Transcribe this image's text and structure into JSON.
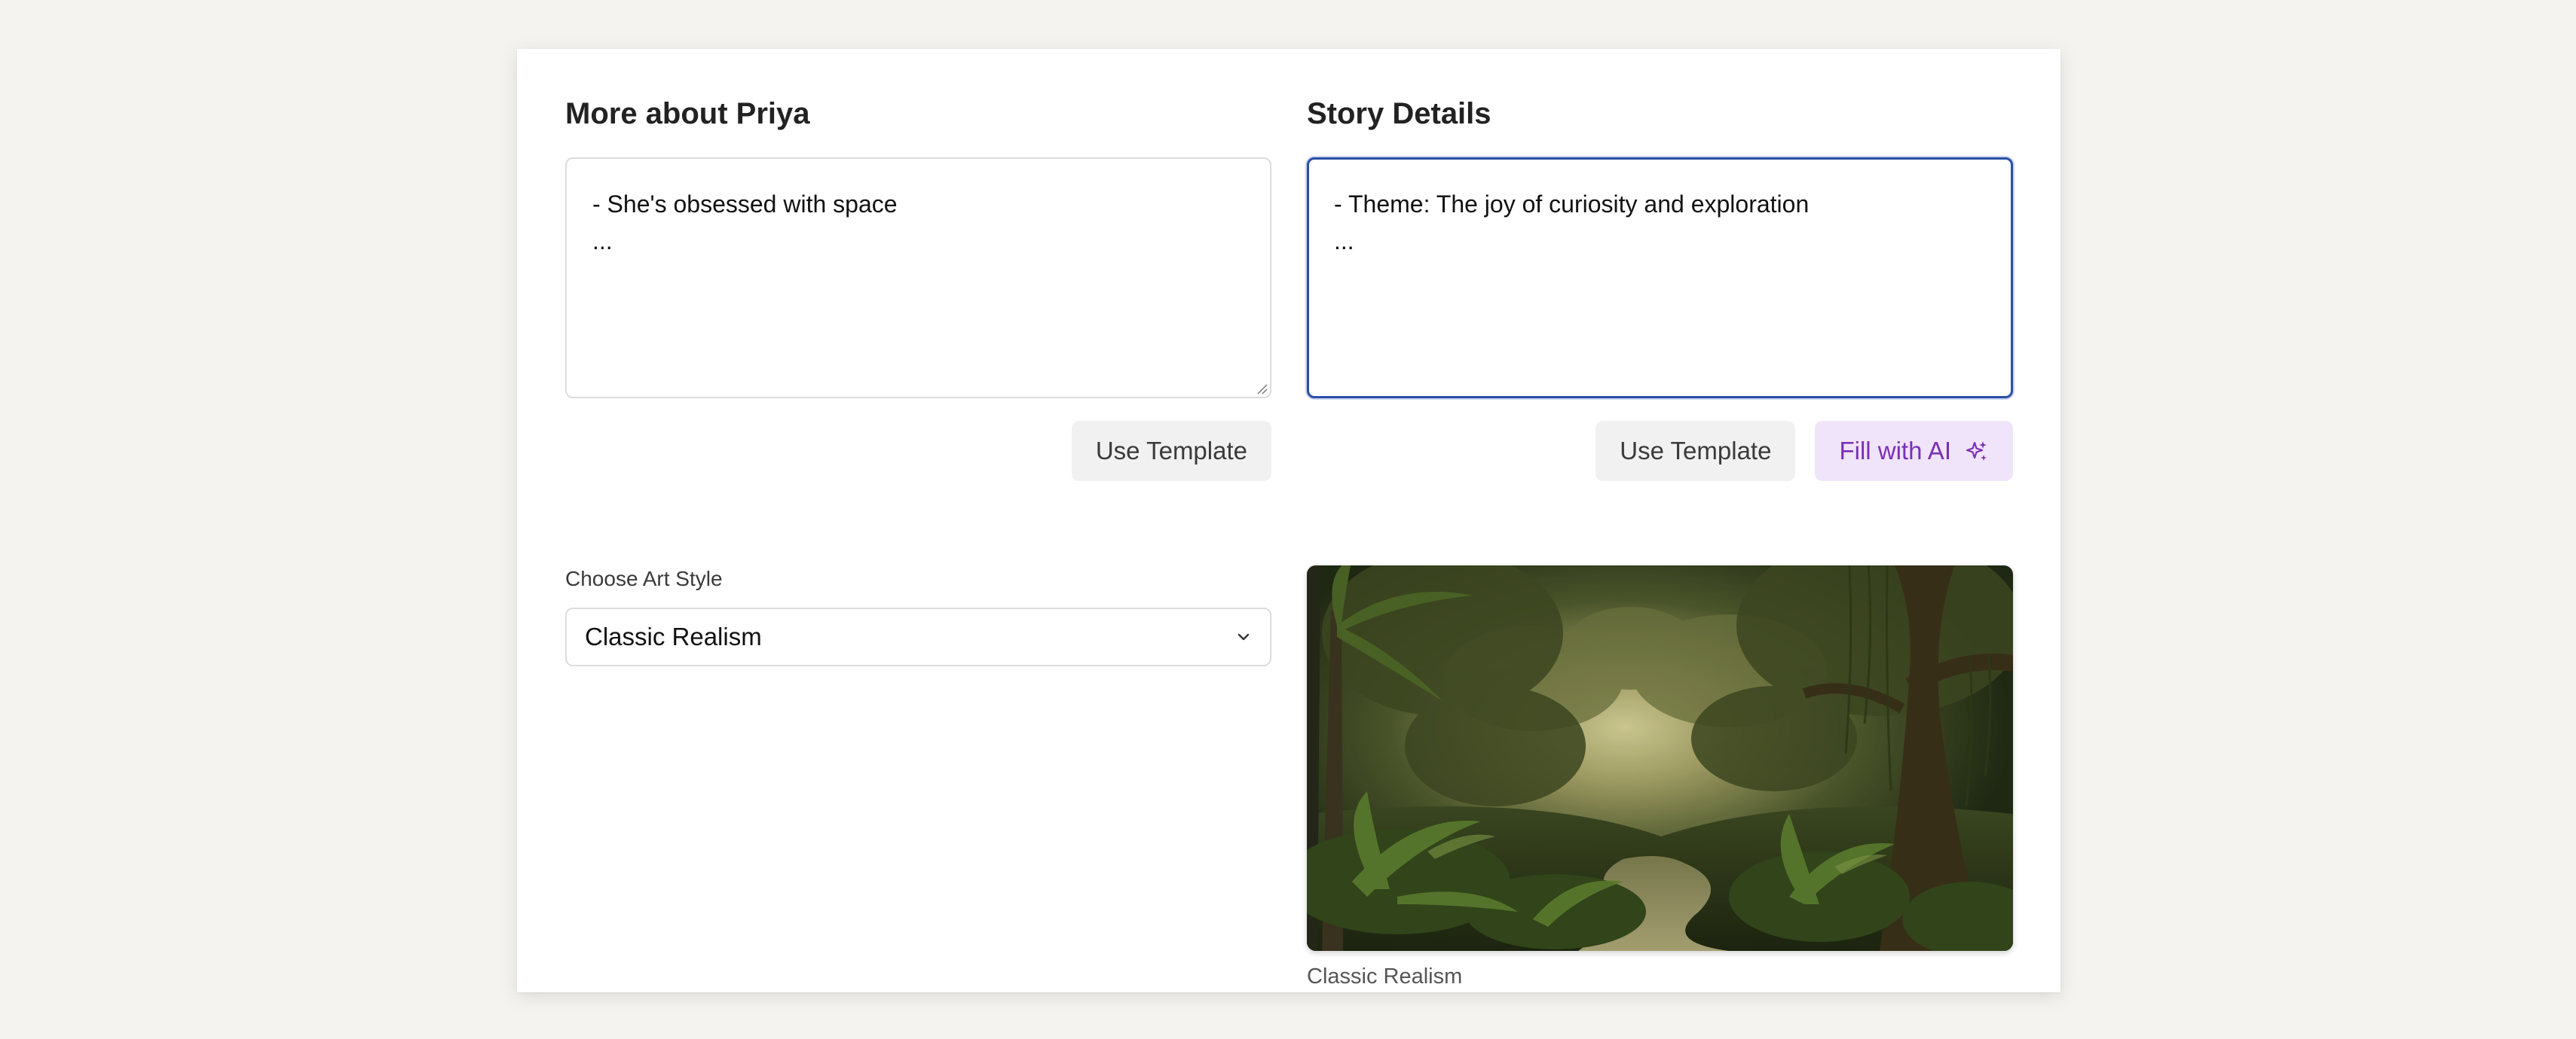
{
  "left_panel": {
    "title": "More about Priya",
    "textarea_value": "- She's obsessed with space\n...",
    "use_template_label": "Use Template",
    "art_style_label": "Choose Art Style",
    "art_style_selected": "Classic Realism"
  },
  "right_panel": {
    "title": "Story Details",
    "textarea_value": "- Theme: The joy of curiosity and exploration\n...",
    "use_template_label": "Use Template",
    "fill_ai_label": "Fill with AI",
    "preview_caption": "Classic Realism"
  },
  "icons": {
    "sparkle": "sparkle-icon",
    "chevron": "chevron-down-icon",
    "resize": "resize-handle-icon"
  },
  "colors": {
    "background": "#f4f3ef",
    "focus_border": "#2a4fa6",
    "ai_button_bg": "#f0e4fb",
    "ai_button_text": "#7b2fb5",
    "secondary_button_bg": "#f1f1f1"
  }
}
